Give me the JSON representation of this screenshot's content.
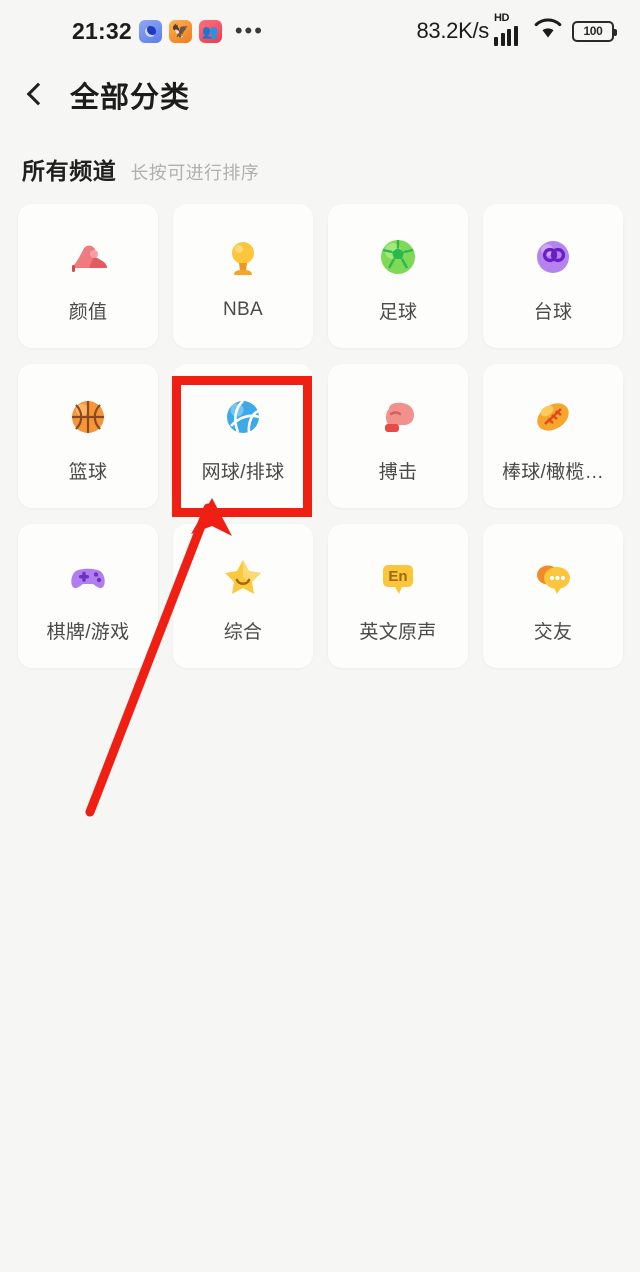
{
  "status_bar": {
    "time": "21:32",
    "app_icons": [
      {
        "name": "app-badge-blue",
        "glyph": ""
      },
      {
        "name": "app-badge-orange",
        "glyph": "🦅"
      },
      {
        "name": "app-badge-red",
        "glyph": "👥"
      }
    ],
    "overflow": "•••",
    "network_speed": "83.2K/s",
    "hd_label": "HD",
    "battery_level": "100"
  },
  "nav": {
    "back_label": "返回",
    "title": "全部分类"
  },
  "section": {
    "title": "所有频道",
    "hint": "长按可进行排序"
  },
  "channels": [
    {
      "label": "颜值",
      "icon": "high-heel-icon"
    },
    {
      "label": "NBA",
      "icon": "trophy-icon"
    },
    {
      "label": "足球",
      "icon": "soccer-ball-icon"
    },
    {
      "label": "台球",
      "icon": "billiards-ball-icon"
    },
    {
      "label": "篮球",
      "icon": "basketball-icon"
    },
    {
      "label": "网球/排球",
      "icon": "volleyball-icon"
    },
    {
      "label": "搏击",
      "icon": "boxing-glove-icon"
    },
    {
      "label": "棒球/橄榄…",
      "icon": "football-icon"
    },
    {
      "label": "棋牌/游戏",
      "icon": "gamepad-icon"
    },
    {
      "label": "综合",
      "icon": "star-icon"
    },
    {
      "label": "英文原声",
      "icon": "english-badge-icon"
    },
    {
      "label": "交友",
      "icon": "chat-bubbles-icon"
    }
  ],
  "annotation": {
    "color": "#f01f13",
    "highlighted_channel": "网球/排球"
  }
}
